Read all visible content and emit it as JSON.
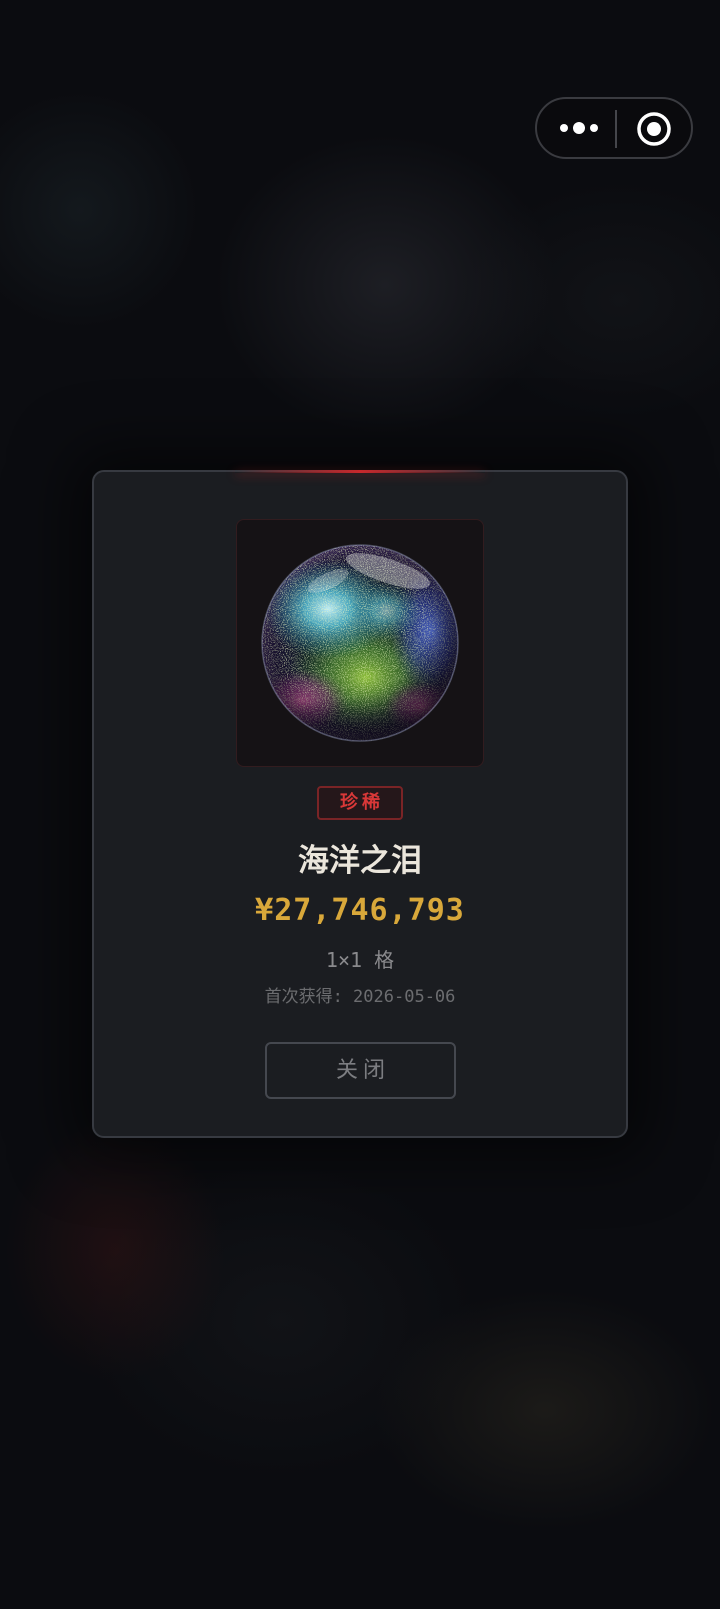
{
  "capsule": {
    "more_icon": "more-dots-icon",
    "close_icon": "target-circle-icon"
  },
  "item": {
    "image_icon": "pearl-orb-image",
    "rarity_label": "珍稀",
    "name": "海洋之泪",
    "price": "¥27,746,793",
    "size": "1×1 格",
    "first_acquired": "首次获得: 2026-05-06"
  },
  "actions": {
    "close_label": "关闭"
  },
  "colors": {
    "background": "#0b0c10",
    "card": "#1b1d21",
    "rarity_accent": "#d83838",
    "price": "#d9a83a",
    "title": "#ebe6dc"
  }
}
